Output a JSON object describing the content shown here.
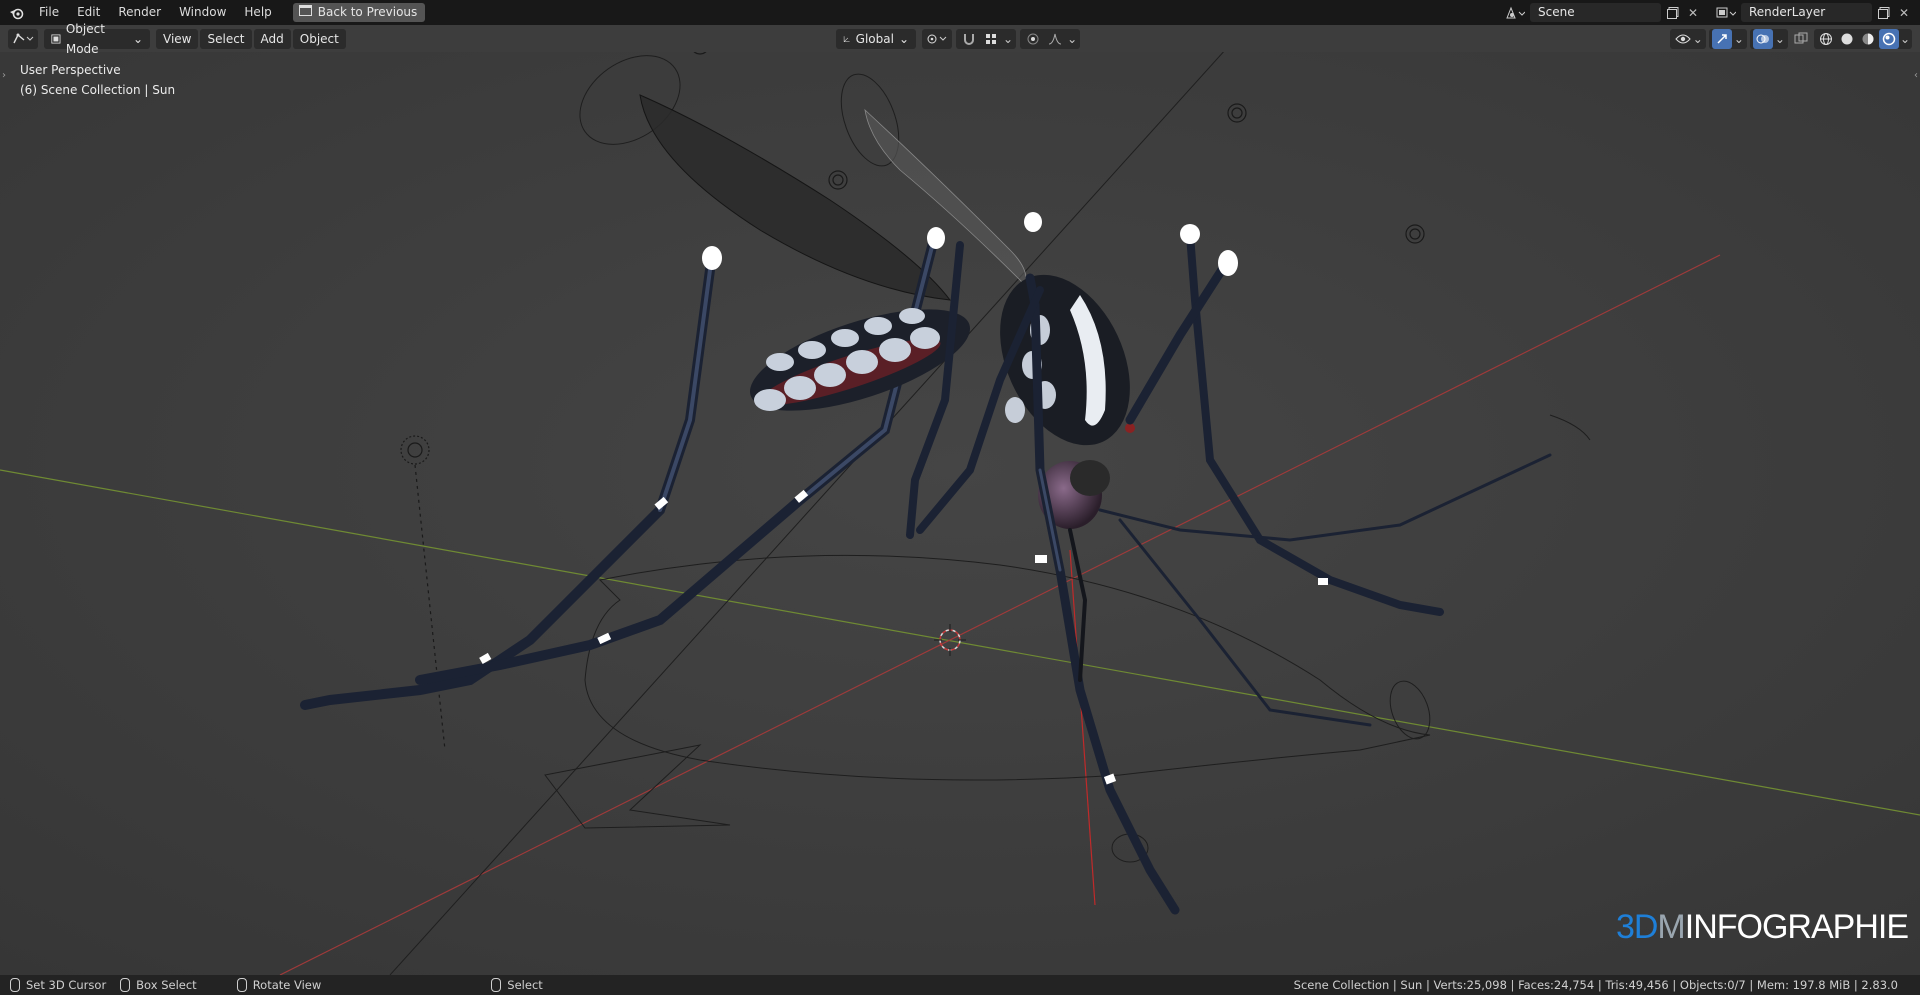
{
  "app": {
    "logo_icon": "blender-icon"
  },
  "menu": [
    "File",
    "Edit",
    "Render",
    "Window",
    "Help"
  ],
  "back_button": {
    "label": "Back to Previous",
    "icon": "back-window-icon"
  },
  "scene": {
    "name": "Scene"
  },
  "render_layer": {
    "name": "RenderLayer"
  },
  "viewport_header": {
    "mode": "Object Mode",
    "menus": [
      "View",
      "Select",
      "Add",
      "Object"
    ],
    "orientation": "Global"
  },
  "viewport_info": {
    "perspective": "User Perspective",
    "collection": "(6) Scene Collection | Sun"
  },
  "watermark": {
    "part_a": "3D",
    "part_b": "M",
    "part_c": "INFOGRAPHIE"
  },
  "statusbar": {
    "left": [
      "Set 3D Cursor",
      "Box Select",
      "Rotate View",
      "Select"
    ],
    "stats": "Scene Collection | Sun | Verts:25,098 | Faces:24,754 | Tris:49,456 | Objects:0/7 | Mem: 197.8 MiB | 2.83.0"
  },
  "colors": {
    "accent": "#4772b3",
    "x_axis": "#b33a3a",
    "y_axis": "#7a9a2e",
    "viewport_bg": "#3d3d3d"
  }
}
